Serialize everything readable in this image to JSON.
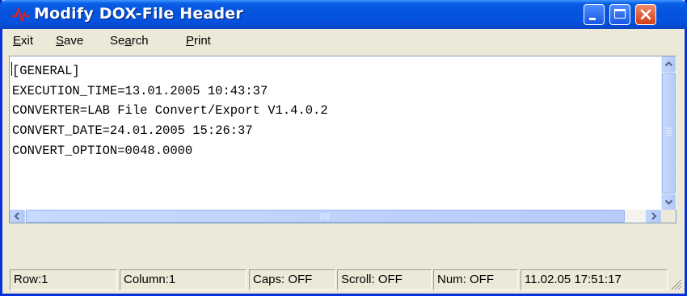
{
  "window": {
    "title": "Modify DOX-File Header",
    "icon": "waveform-icon",
    "controls": {
      "minimize": "minimize-icon",
      "maximize": "maximize-icon",
      "close": "close-icon"
    }
  },
  "menu": [
    {
      "pre": "",
      "ul": "E",
      "post": "xit"
    },
    {
      "pre": "",
      "ul": "S",
      "post": "ave"
    },
    {
      "pre": "Se",
      "ul": "a",
      "post": "rch"
    },
    {
      "pre": "",
      "ul": "P",
      "post": "rint"
    }
  ],
  "editor": {
    "lines": [
      "[GENERAL]",
      "EXECUTION_TIME=13.01.2005 10:43:37",
      "CONVERTER=LAB File Convert/Export V1.4.0.2",
      "CONVERT_DATE=24.01.2005 15:26:37",
      "CONVERT_OPTION=0048.0000"
    ]
  },
  "status": {
    "row": "Row:1",
    "column": "Column:1",
    "caps": "Caps: OFF",
    "scroll": "Scroll: OFF",
    "num": "Num: OFF",
    "datetime": "11.02.05 17:51:17"
  },
  "colors": {
    "titlebar": "#0453dc",
    "close_button": "#d43e17",
    "frame": "#ece9d8"
  }
}
